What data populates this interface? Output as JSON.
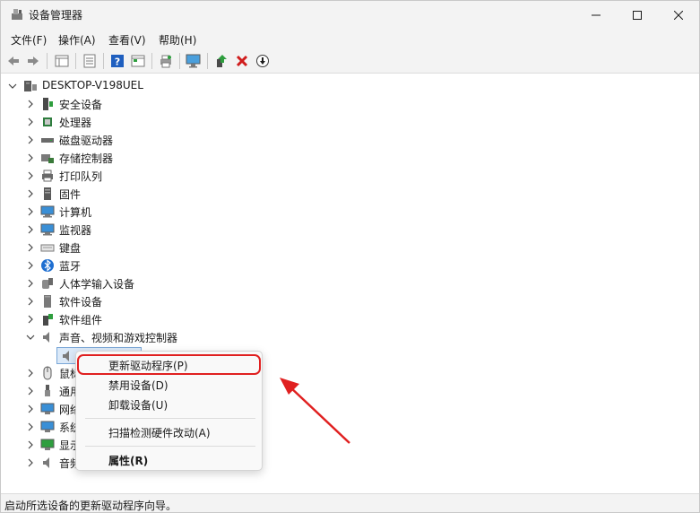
{
  "window": {
    "title": "设备管理器"
  },
  "menubar": {
    "items": [
      "文件(F)",
      "操作(A)",
      "查看(V)",
      "帮助(H)"
    ]
  },
  "toolbar": {
    "icons": [
      "back-arrow-icon",
      "forward-arrow-icon",
      "properties-grid-icon",
      "properties-sheet-icon",
      "help-icon",
      "view-grid-icon",
      "print-icon",
      "update-driver-icon",
      "monitor-scan-icon",
      "enable-device-icon",
      "uninstall-icon",
      "disable-device-icon"
    ]
  },
  "tree": {
    "root": "DESKTOP-V198UEL",
    "items": [
      {
        "label": "安全设备",
        "icon": "security-device-icon"
      },
      {
        "label": "处理器",
        "icon": "processor-icon"
      },
      {
        "label": "磁盘驱动器",
        "icon": "disk-drive-icon"
      },
      {
        "label": "存储控制器",
        "icon": "storage-controller-icon"
      },
      {
        "label": "打印队列",
        "icon": "print-queue-icon"
      },
      {
        "label": "固件",
        "icon": "firmware-icon"
      },
      {
        "label": "计算机",
        "icon": "computer-icon"
      },
      {
        "label": "监视器",
        "icon": "monitor-icon"
      },
      {
        "label": "键盘",
        "icon": "keyboard-icon"
      },
      {
        "label": "蓝牙",
        "icon": "bluetooth-icon"
      },
      {
        "label": "人体学输入设备",
        "icon": "hid-icon"
      },
      {
        "label": "软件设备",
        "icon": "software-device-icon"
      },
      {
        "label": "软件组件",
        "icon": "software-component-icon"
      },
      {
        "label": "声音、视频和游戏控制器",
        "icon": "speaker-icon",
        "expanded": true
      },
      {
        "label": "鼠标",
        "icon": "mouse-icon"
      },
      {
        "label": "通用",
        "icon": "usb-icon"
      },
      {
        "label": "网络",
        "icon": "network-icon"
      },
      {
        "label": "系统",
        "icon": "system-icon"
      },
      {
        "label": "显示",
        "icon": "display-icon"
      },
      {
        "label": "音频",
        "icon": "audio-icon"
      }
    ]
  },
  "context_menu": {
    "items": [
      "更新驱动程序(P)",
      "禁用设备(D)",
      "卸载设备(U)",
      "扫描检测硬件改动(A)",
      "属性(R)"
    ]
  },
  "status": {
    "text": "启动所选设备的更新驱动程序向导。"
  },
  "colors": {
    "highlight": "#e02020",
    "accent": "#0067c0",
    "selection": "#dbe9f8"
  }
}
